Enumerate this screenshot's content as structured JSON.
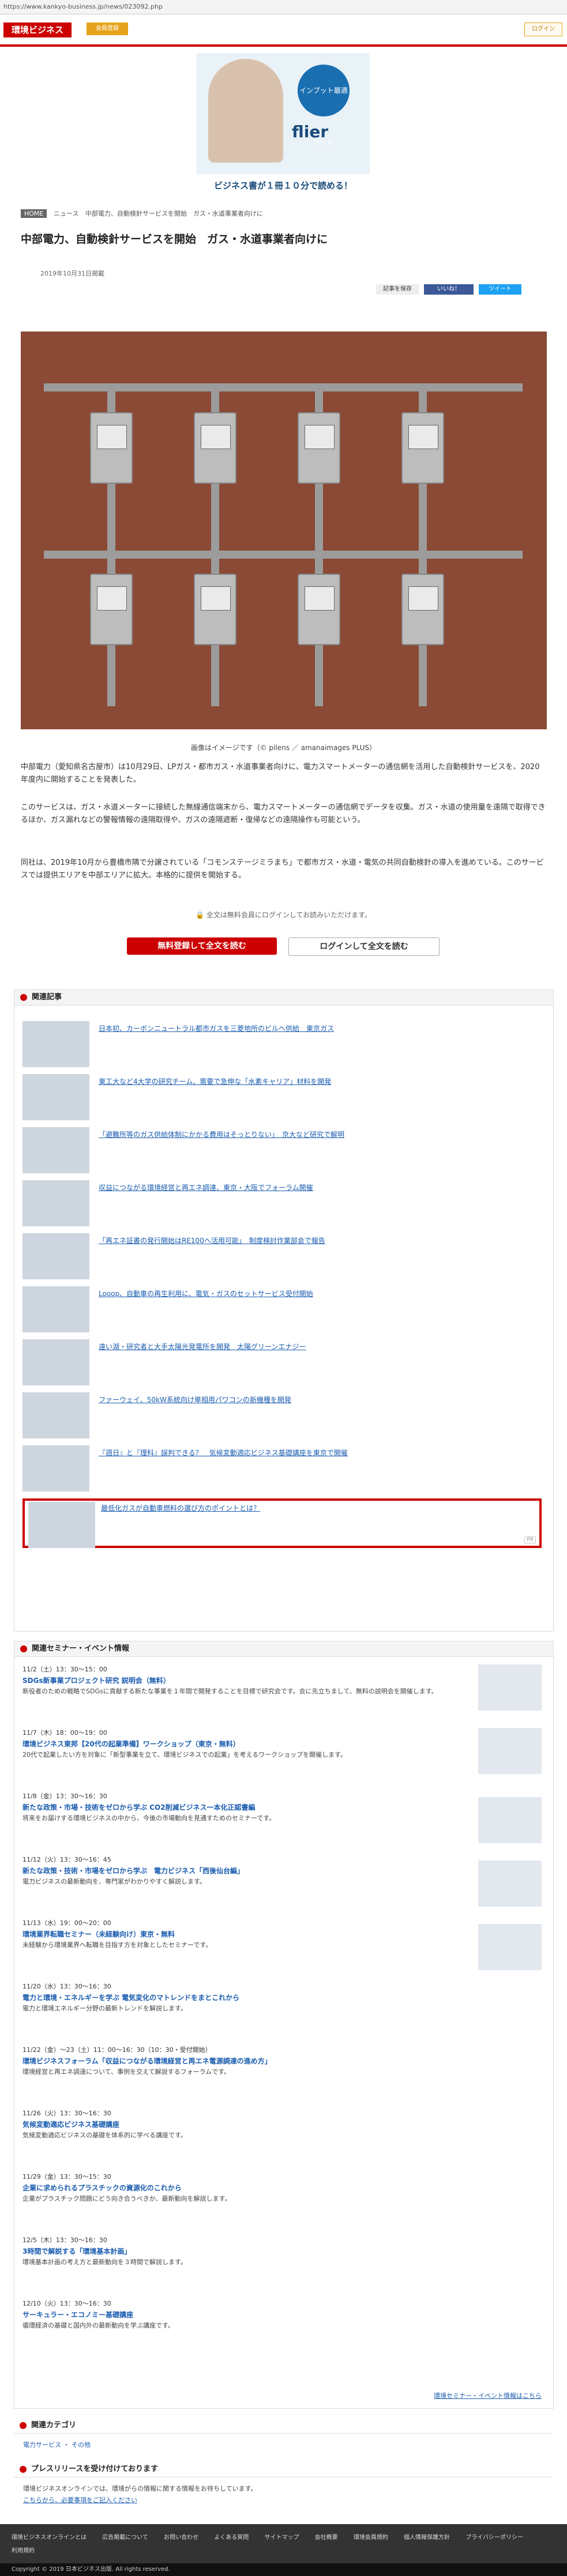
{
  "browser": {
    "url": "https://www.kankyo-business.jp/news/023092.php"
  },
  "header": {
    "logo": "環境ビジネス",
    "nav_button": "会員登録",
    "login_button": "ログイン"
  },
  "banner": {
    "brand": "flier",
    "badge": "インプット最適ツール",
    "tagline": "ビジネス書が１冊１０分で読める！"
  },
  "breadcrumb": [
    "HOME",
    "ニュース",
    "中部電力、自動検針サービスを開始　ガス・水道事業者向けに"
  ],
  "article": {
    "title": "中部電力、自動検針サービスを開始　ガス・水道事業者向けに",
    "date": "2019年10月31日掲載",
    "share": {
      "bookmark": "記事を保存",
      "facebook": "いいね！",
      "twitter": "ツイート"
    },
    "caption": "画像はイメージです（© pilens ／ amanaimages PLUS）",
    "paragraphs": [
      "中部電力（愛知県名古屋市）は10月29日、LPガス・都市ガス・水道事業者向けに、電力スマートメーターの通信網を活用した自動検針サービスを、2020年度内に開始することを発表した。",
      "このサービスは、ガス・水道メーターに接続した無線通信端末から、電力スマートメーターの通信網でデータを収集。ガス・水道の使用量を遠隔で取得できるほか、ガス漏れなどの警報情報の遠隔取得や、ガスの遠隔遮断・復帰などの遠隔操作も可能という。",
      "同社は、2019年10月から豊橋市隣で分譲されている「コモンステージミラまち」で都市ガス・水道・電気の共同自動検針の導入を進めている。このサービスでは提供エリアを中部エリアに拡大。本格的に提供を開始する。"
    ],
    "lock_note": "全文は無料会員にログインしてお読みいただけます。",
    "register_button": "無料登録して全文を読む",
    "login_button": "ログインして全文を読む"
  },
  "related": {
    "title": "関連記事",
    "items": [
      "日本初、カーボンニュートラル都市ガスを三菱地所のビルへ供給　東京ガス",
      "東工大など4大学の研究チーム、需要で急伸な「水素キャリア」材料を開発",
      "「避難所等のガス供給体制にかかる費用はそっとりない」　京大など研究で解明",
      "収益につながる環境経営と再エネ調達、東京・大阪でフォーラム開催",
      "「再エネ証書の発行開始はRE100へ活用可能」　制度検討作業部会で報告",
      "Looop、自動車の再生利用に、電気・ガスのセットサービス受付開始",
      "遠い湖・研究者と大手太陽光発電所を開発　太陽グリーンエナジー",
      "ファーウェイ、50kW系統向け単相用パワコンの新機種を開発",
      "『週日』と『理科』誤判できる？　気候変動適応ビジネス基礎講座を東京で開催"
    ],
    "ad": {
      "title": "最低化ガスが自動車燃料の選び方のポイントとは？",
      "label": "PR"
    }
  },
  "seminars": {
    "title": "関連セミナー・イベント情報",
    "items": [
      {
        "date": "11/2（土）13：30〜15：00",
        "title": "SDGs新事業プロジェクト研究 説明会（無料）",
        "desc": "新役者のための戦略でSDGsに貢献する新たな事業を１年間で開発することを目標で研究会です。会に先立ちまして、無料の説明会を開催します。"
      },
      {
        "date": "11/7（木）18：00〜19：00",
        "title": "環境ビジネス東邦【20代の起業準備】ワークショップ（東京・無料）",
        "desc": "20代で起業したい方を対象に「新型事業を立て、環境ビジネスでの起業」を考えるワークショップを開催します。"
      },
      {
        "date": "11/8（金）13：30〜16：30",
        "title": "新たな政策・市場・技術をゼロから学ぶ CO2削減ビジネス一本化正認書編",
        "desc": "将来をお届けする環境ビジネスの中から、今後の市場動向を見通すためのセミナーです。"
      },
      {
        "date": "11/12（火）13：30〜16：45",
        "title": "新たな政策・技術・市場をゼロから学ぶ　電力ビジネス「西後仙台編」",
        "desc": "電力ビジネスの最新動向を、専門家がわかりやすく解説します。"
      },
      {
        "date": "11/13（水）19：00〜20：00",
        "title": "環境業界転職セミナー（未経験向け）東京・無料",
        "desc": "未経験から環境業界へ転職を目指す方を対象としたセミナーです。"
      },
      {
        "date": "11/20（水）13：30〜16：30",
        "title": "電力と環境・エネルギーを学ぶ 電気変化のマトレンドをまとこれから",
        "desc": "電力と環境エネルギー分野の最新トレンドを解説します。"
      },
      {
        "date": "11/22（金）〜23（土）11：00〜16：30（10：30・受付開始）",
        "title": "環境ビジネスフォーラム「収益につながる環境経営と再エネ電源調達の進め方」",
        "desc": "環境経営と再エネ調達について、事例を交えて解説するフォーラムです。"
      },
      {
        "date": "11/26（火）13：30〜16：30",
        "title": "気候変動適応ビジネス基礎講座",
        "desc": "気候変動適応ビジネスの基礎を体系的に学べる講座です。"
      },
      {
        "date": "11/29（金）13：30〜15：30",
        "title": "企業に求められるプラスチックの資源化のこれから",
        "desc": "企業がプラスチック問題にどう向き合うべきか、最新動向を解説します。"
      },
      {
        "date": "12/5（木）13：30〜16：30",
        "title": "3時間で解説する「環境基本計画」",
        "desc": "環境基本計画の考え方と最新動向を３時間で解説します。"
      },
      {
        "date": "12/10（火）13：30〜16：30",
        "title": "サーキュラー・エコノミー基礎講座",
        "desc": "循環経済の基礎と国内外の最新動向を学ぶ講座です。"
      }
    ],
    "more": "環境セミナー・イベント情報はこちら"
  },
  "category": {
    "title": "関連カテゴリ",
    "links": [
      "電力サービス",
      "その他"
    ]
  },
  "press": {
    "title": "プレスリリースを受け付けております",
    "text": "環境ビジネスオンラインでは、環境がらの情報に関する情報をお待ちしています。",
    "link": "こちらから、必要事項をご記入ください"
  },
  "footer": {
    "links": [
      "環境ビジネスオンラインとは",
      "広告掲載について",
      "お問い合わせ",
      "よくある質問",
      "サイトマップ",
      "会社概要",
      "環境会員規約",
      "個人情報保護方針",
      "プライバシーポリシー",
      "利用規約"
    ],
    "copyright": "Copyright © 2019 日本ビジネス出版. All rights reserved."
  }
}
